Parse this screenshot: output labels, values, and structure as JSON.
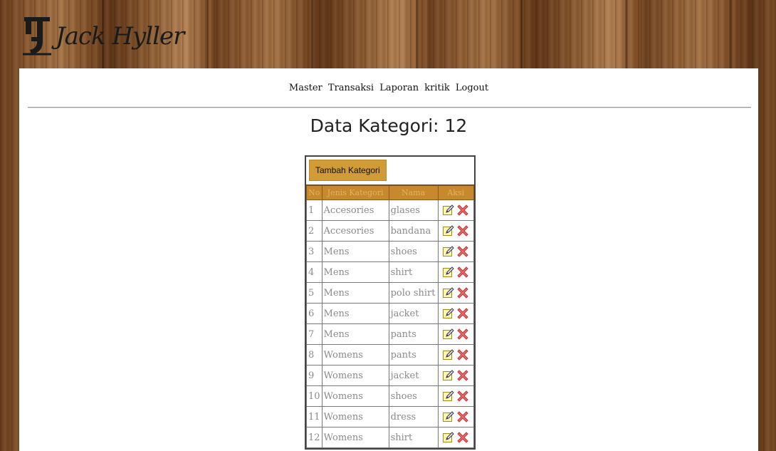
{
  "brand": {
    "logo_text": "Jack Hyller",
    "logo_icon": "jh-monogram-icon"
  },
  "nav": {
    "items": [
      "Master",
      "Transaksi",
      "Laporan",
      "kritik",
      "Logout"
    ]
  },
  "page": {
    "title": "Data Kategori: 12"
  },
  "toolbar": {
    "add_label": "Tambah Kategori"
  },
  "table": {
    "headers": [
      "No",
      "Jenis Kategori",
      "Nama",
      "Aksi"
    ],
    "rows": [
      {
        "no": "1",
        "jenis": "Accesories",
        "nama": "glases"
      },
      {
        "no": "2",
        "jenis": "Accesories",
        "nama": "bandana"
      },
      {
        "no": "3",
        "jenis": "Mens",
        "nama": "shoes"
      },
      {
        "no": "4",
        "jenis": "Mens",
        "nama": "shirt"
      },
      {
        "no": "5",
        "jenis": "Mens",
        "nama": "polo shirt"
      },
      {
        "no": "6",
        "jenis": "Mens",
        "nama": "jacket"
      },
      {
        "no": "7",
        "jenis": "Mens",
        "nama": "pants"
      },
      {
        "no": "8",
        "jenis": "Womens",
        "nama": "pants"
      },
      {
        "no": "9",
        "jenis": "Womens",
        "nama": "jacket"
      },
      {
        "no": "10",
        "jenis": "Womens",
        "nama": "shoes"
      },
      {
        "no": "11",
        "jenis": "Womens",
        "nama": "dress"
      },
      {
        "no": "12",
        "jenis": "Womens",
        "nama": "shirt"
      }
    ],
    "row_actions": [
      "edit-icon",
      "delete-icon"
    ]
  },
  "colors": {
    "header_bg": "#c7892c",
    "button_bg": "#d19b35",
    "cell_text": "#8a8a8a"
  }
}
